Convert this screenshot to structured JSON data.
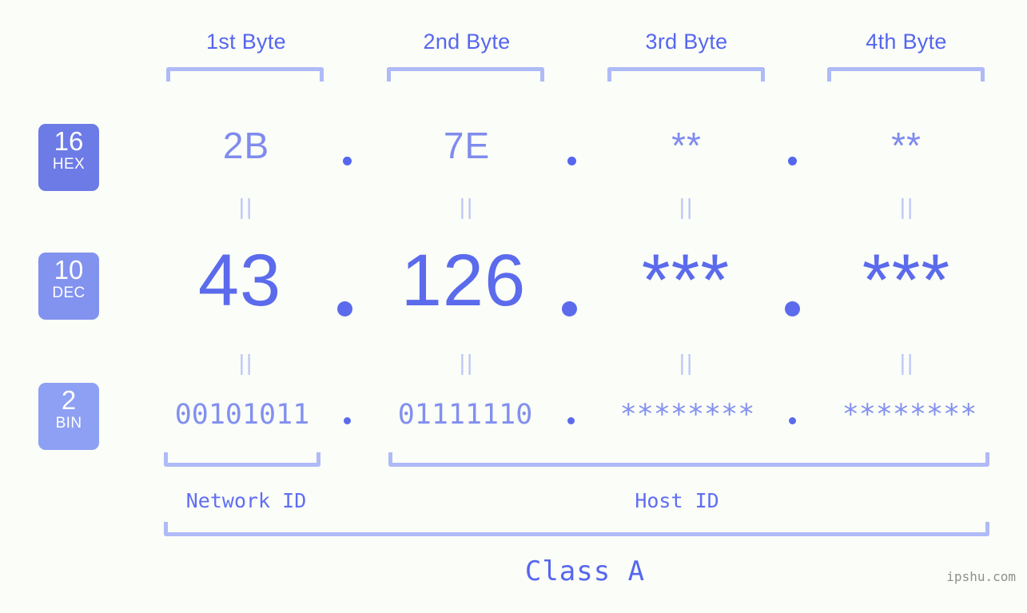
{
  "bytes": {
    "headers": [
      "1st Byte",
      "2nd Byte",
      "3rd Byte",
      "4th Byte"
    ]
  },
  "rows": [
    {
      "base": "16",
      "base_name": "HEX",
      "values": [
        "2B",
        "7E",
        "**",
        "**"
      ],
      "separator": "."
    },
    {
      "base": "10",
      "base_name": "DEC",
      "values": [
        "43",
        "126",
        "***",
        "***"
      ],
      "separator": "."
    },
    {
      "base": "2",
      "base_name": "BIN",
      "values": [
        "00101011",
        "01111110",
        "********",
        "********"
      ],
      "separator": "."
    }
  ],
  "connector": "||",
  "segments": {
    "network_id": "Network ID",
    "host_id": "Host ID"
  },
  "class_label": "Class A",
  "watermark": "ipshu.com",
  "colors": {
    "background": "#fbfdf8",
    "header_text": "#5566ef",
    "bracket": "#afbaf7",
    "hex_value": "#7f8bee",
    "dec_value": "#5b6bec",
    "bin_value": "#8290ef",
    "badge_hex": "#6d7be7",
    "badge_dec": "#8292ef",
    "badge_bin": "#8da0f3",
    "connector": "#bcc6f8",
    "watermark": "#8f8f8f"
  }
}
